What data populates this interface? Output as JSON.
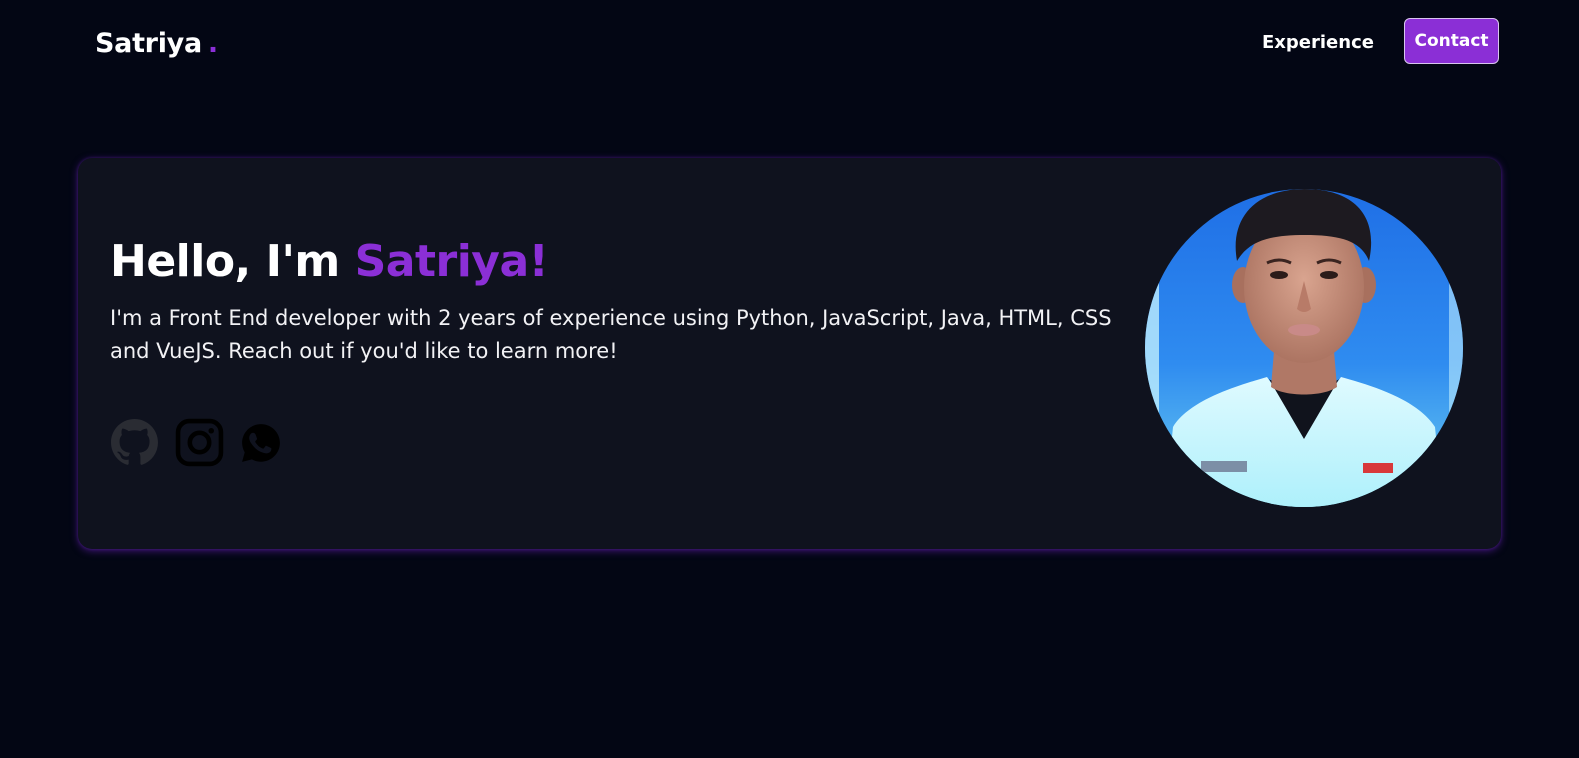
{
  "header": {
    "brand": "Satriya",
    "brand_dot": ".",
    "nav": {
      "experience_label": "Experience",
      "contact_label": "Contact"
    }
  },
  "hero": {
    "greeting": "Hello, I'm",
    "name": "Satriya!",
    "description": "I'm a Front End developer with 2 years of experience using Python, JavaScript, Java, HTML, CSS and VueJS. Reach out if you'd like to learn more!",
    "socials": [
      {
        "icon": "github-icon"
      },
      {
        "icon": "instagram-icon"
      },
      {
        "icon": "whatsapp-icon"
      }
    ],
    "avatar": "profile-photo"
  },
  "colors": {
    "background": "#030614",
    "card": "#0f121e",
    "accent": "#8b2fd6",
    "text": "#ffffff"
  }
}
